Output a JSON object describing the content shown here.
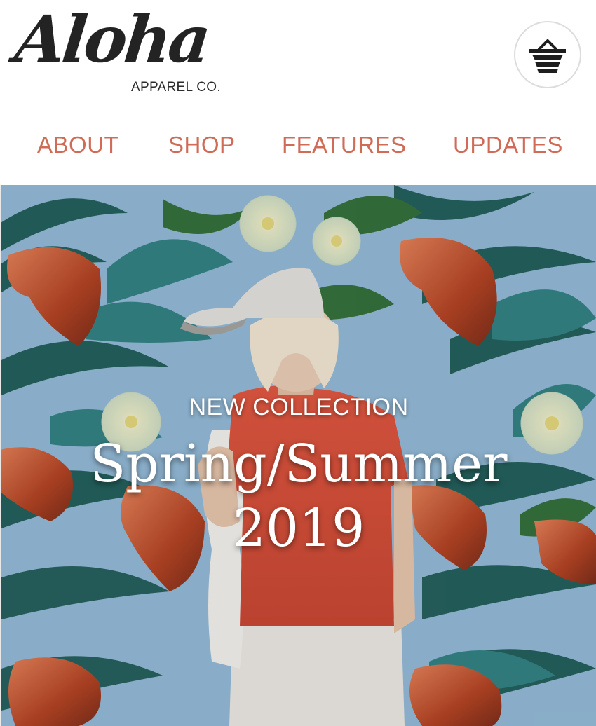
{
  "brand": {
    "logo_script": "Aloha",
    "logo_subtitle": "APPAREL CO.",
    "accent_color": "#cf6b57",
    "text_color": "#232323"
  },
  "header": {
    "cart_icon": "shopping-basket-icon"
  },
  "nav": {
    "items": [
      {
        "label": "ABOUT"
      },
      {
        "label": "SHOP"
      },
      {
        "label": "FEATURES"
      },
      {
        "label": "UPDATES"
      }
    ]
  },
  "hero": {
    "kicker": "NEW COLLECTION",
    "title_line1": "Spring/Summer",
    "title_line2": "2019",
    "background_color": "#8fb7d3"
  }
}
